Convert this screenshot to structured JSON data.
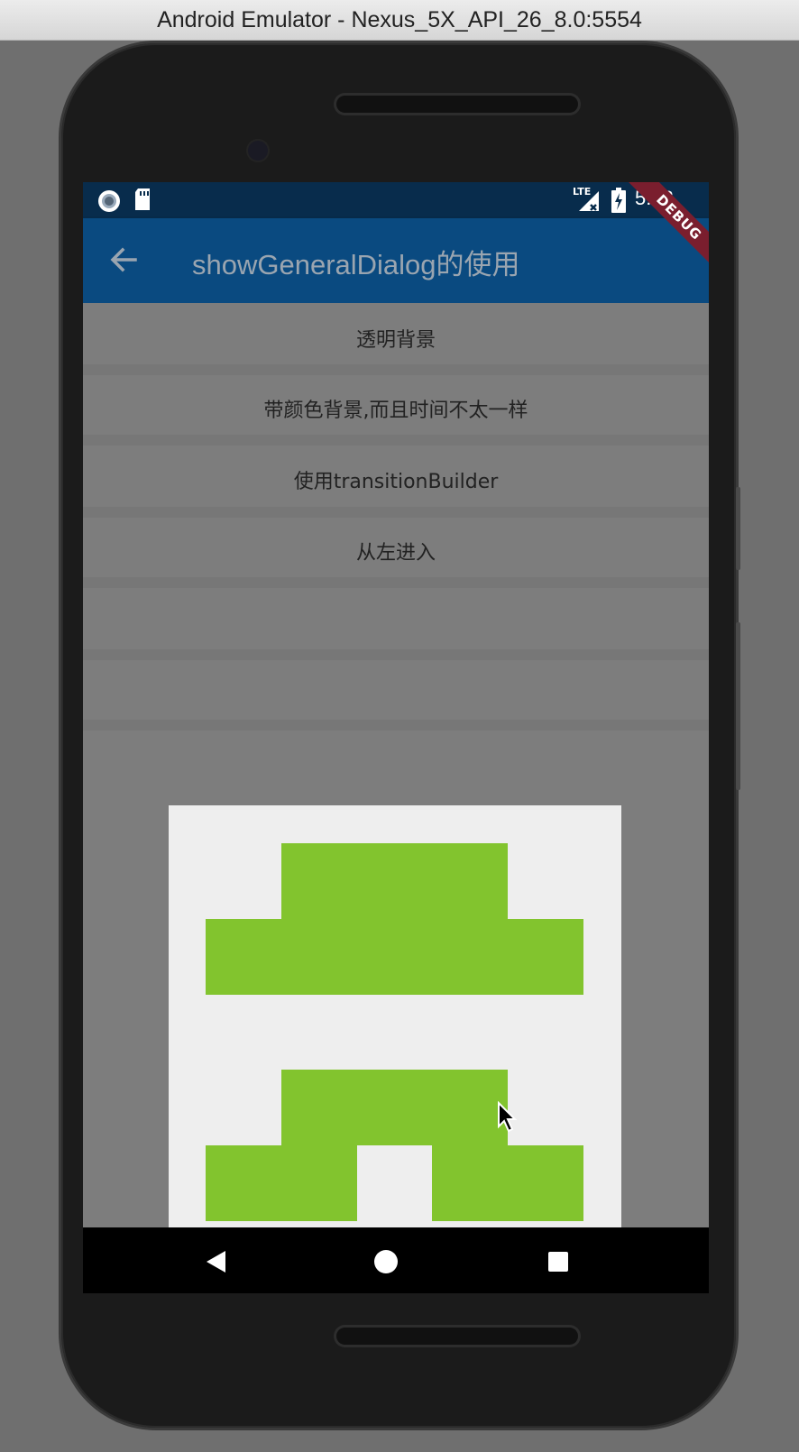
{
  "window": {
    "title": "Android Emulator - Nexus_5X_API_26_8.0:5554"
  },
  "status_bar": {
    "time": "5:43",
    "left_icons": [
      "notification-dot-icon",
      "sd-card-icon"
    ],
    "right_icons": [
      "lte-signal-icon",
      "battery-charging-icon"
    ],
    "lte_label": "LTE"
  },
  "debug_banner": {
    "label": "DEBUG"
  },
  "app_bar": {
    "title": "showGeneralDialog的使用",
    "back_icon": "arrow-back-icon"
  },
  "list": {
    "items": [
      {
        "label": "透明背景"
      },
      {
        "label": "带颜色背景,而且时间不太一样"
      },
      {
        "label": "使用transitionBuilder"
      },
      {
        "label": "从左进入"
      }
    ]
  },
  "dialog": {
    "content": "pixel-art-graphic",
    "accent_color": "#82c42e",
    "background_color": "#eeeeee"
  },
  "colors": {
    "status_bar": "#082c4c",
    "app_bar": "#0a4a80",
    "scrim": "#7d7d7d",
    "debug_banner": "#7a1e2e"
  },
  "nav_bar": {
    "buttons": [
      "back-triangle-icon",
      "home-circle-icon",
      "recents-square-icon"
    ]
  }
}
